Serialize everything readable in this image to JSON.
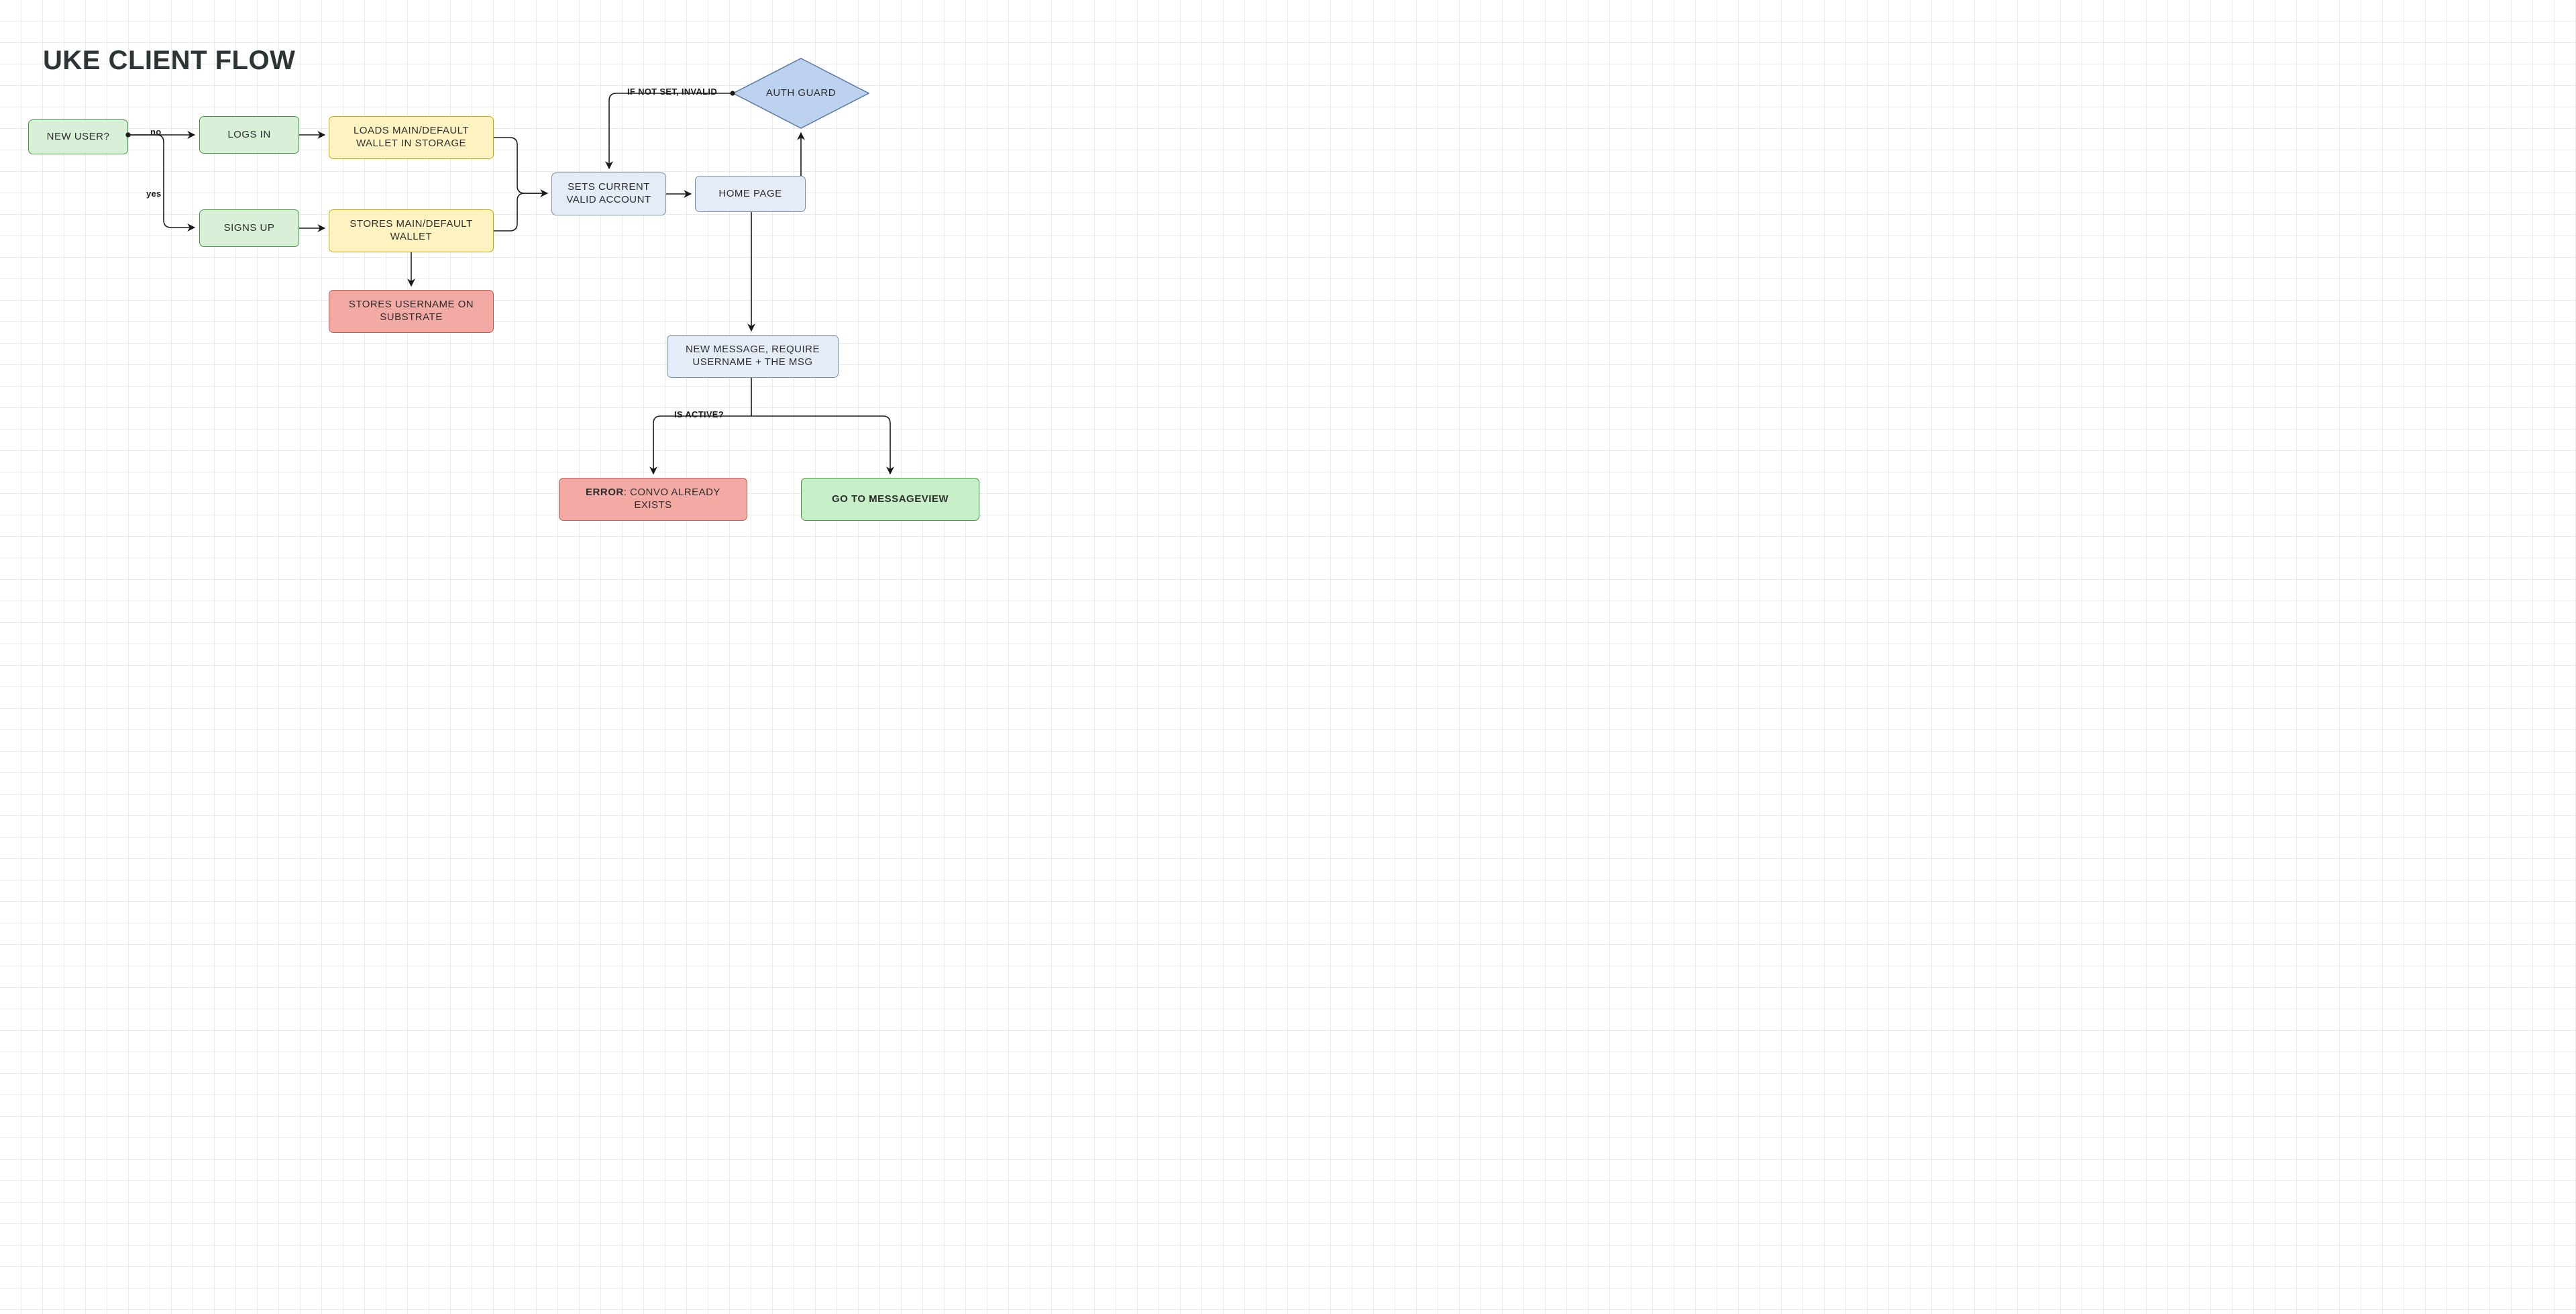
{
  "title": "UKE CLIENT FLOW",
  "nodes": {
    "new_user": "NEW USER?",
    "logs_in": "LOGS IN",
    "signs_up": "SIGNS UP",
    "loads_wallet": "LOADS MAIN/DEFAULT WALLET IN STORAGE",
    "stores_wallet": "STORES MAIN/DEFAULT WALLET",
    "stores_username": "STORES USERNAME ON SUBSTRATE",
    "sets_valid": "SETS CURRENT VALID ACCOUNT",
    "home_page": "HOME PAGE",
    "auth_guard": "AUTH GUARD",
    "new_message": "NEW MESSAGE, REQUIRE USERNAME + THE MSG",
    "go_message": "GO TO MESSAGEVIEW"
  },
  "error_node": {
    "prefix": "ERROR",
    "rest": ": CONVO ALREADY EXISTS"
  },
  "edge_labels": {
    "no": "no",
    "yes": "yes",
    "if_not_set": "IF NOT SET, INVALID",
    "is_active": "IS ACTIVE?"
  },
  "colors": {
    "green_fill": "#d8f0d8",
    "green_stroke": "#3d9a3d",
    "yellow_fill": "#fff3c2",
    "yellow_stroke": "#c9a800",
    "blue_fill": "#e4ecf7",
    "blue_stroke": "#7a8fa6",
    "red_fill": "#f3aaa4",
    "red_stroke": "#bb5a50",
    "diamond_fill": "#bcd2ee",
    "diamond_stroke": "#5a7aa6"
  }
}
